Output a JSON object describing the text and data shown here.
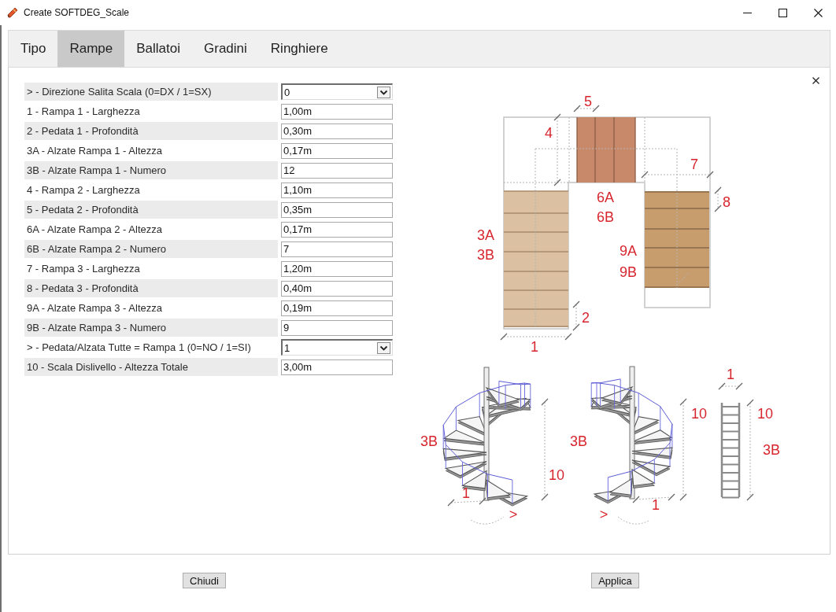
{
  "window": {
    "title": "Create SOFTDEG_Scale"
  },
  "tabs": [
    {
      "label": "Tipo",
      "selected": false
    },
    {
      "label": "Rampe",
      "selected": true
    },
    {
      "label": "Ballatoi",
      "selected": false
    },
    {
      "label": "Gradini",
      "selected": false
    },
    {
      "label": "Ringhiere",
      "selected": false
    }
  ],
  "fields": [
    {
      "kind": "select",
      "label": "> - Direzione Salita Scala (0=DX / 1=SX)",
      "value": "0"
    },
    {
      "kind": "text",
      "label": "1 - Rampa 1 - Larghezza",
      "value": "1,00m"
    },
    {
      "kind": "text",
      "label": "2 - Pedata 1 - Profondità",
      "value": "0,30m"
    },
    {
      "kind": "text",
      "label": "3A - Alzate Rampa 1 - Altezza",
      "value": "0,17m"
    },
    {
      "kind": "text",
      "label": "3B - Alzate Rampa 1 - Numero",
      "value": "12"
    },
    {
      "kind": "text",
      "label": "4 - Rampa 2 - Larghezza",
      "value": "1,10m"
    },
    {
      "kind": "text",
      "label": "5 - Pedata 2 - Profondità",
      "value": "0,35m"
    },
    {
      "kind": "text",
      "label": "6A - Alzate Rampa 2 - Altezza",
      "value": "0,17m"
    },
    {
      "kind": "text",
      "label": "6B - Alzate Rampa 2 - Numero",
      "value": "7"
    },
    {
      "kind": "text",
      "label": "7 - Rampa 3 - Larghezza",
      "value": "1,20m"
    },
    {
      "kind": "text",
      "label": "8 - Pedata 3 - Profondità",
      "value": "0,40m"
    },
    {
      "kind": "text",
      "label": "9A - Alzate Rampa 3 - Altezza",
      "value": "0,19m"
    },
    {
      "kind": "text",
      "label": "9B - Alzate Rampa 3 - Numero",
      "value": "9"
    },
    {
      "kind": "select",
      "label": "> - Pedata/Alzata Tutte = Rampa 1 (0=NO / 1=SI)",
      "value": "1"
    },
    {
      "kind": "text",
      "label": "10 - Scala Dislivello - Altezza Totale",
      "value": "3,00m"
    }
  ],
  "plan_view": {
    "labels": [
      "5",
      "4",
      "7",
      "6A",
      "6B",
      "8",
      "3A",
      "3B",
      "9A",
      "9B",
      "2",
      "1"
    ]
  },
  "spiral_view_1": {
    "labels": [
      "3B",
      "10",
      "1",
      ">"
    ]
  },
  "spiral_view_2": {
    "labels": [
      "3B",
      "10",
      "1",
      ">"
    ]
  },
  "ladder_view": {
    "labels": [
      "1",
      "10",
      "3B"
    ]
  },
  "buttons": [
    "Chiudi",
    "Applica"
  ]
}
